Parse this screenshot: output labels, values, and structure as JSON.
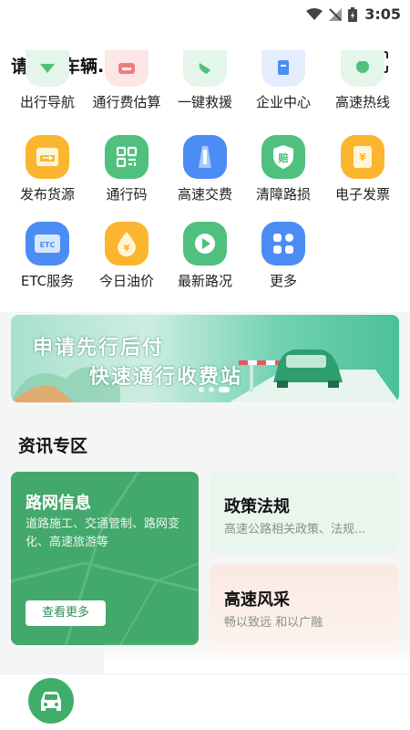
{
  "status": {
    "time": "3:05"
  },
  "header": {
    "title": "请绑定车辆..."
  },
  "menu": [
    {
      "label": "出行导航",
      "icon": "navigation-icon",
      "color": "#4fc07e"
    },
    {
      "label": "通行费估算",
      "icon": "toll-estimate-icon",
      "color": "#f47c7c"
    },
    {
      "label": "一键救援",
      "icon": "phone-icon",
      "color": "#4fc07e"
    },
    {
      "label": "企业中心",
      "icon": "document-icon",
      "color": "#4b8cf5"
    },
    {
      "label": "高速热线",
      "icon": "hotline-icon",
      "color": "#4fc07e"
    },
    {
      "label": "发布货源",
      "icon": "truck-icon",
      "color": "#fcb52e"
    },
    {
      "label": "通行码",
      "icon": "qrcode-icon",
      "color": "#4fc07e"
    },
    {
      "label": "高速交费",
      "icon": "highway-pay-icon",
      "color": "#4b8cf5"
    },
    {
      "label": "清障路损",
      "icon": "compensate-icon",
      "color": "#4fc07e"
    },
    {
      "label": "电子发票",
      "icon": "invoice-icon",
      "color": "#fcb52e"
    },
    {
      "label": "ETC服务",
      "icon": "etc-card-icon",
      "color": "#4b8cf5"
    },
    {
      "label": "今日油价",
      "icon": "oil-drop-icon",
      "color": "#fcb52e"
    },
    {
      "label": "最新路况",
      "icon": "play-icon",
      "color": "#4fc07e"
    },
    {
      "label": "更多",
      "icon": "more-grid-icon",
      "color": "#4b8cf5"
    }
  ],
  "banner": {
    "line1": "申请先行后付",
    "line2": "快速通行收费站"
  },
  "news": {
    "title": "资讯专区",
    "road": {
      "title": "路网信息",
      "desc": "道路施工、交通管制、路网变化、高速旅游等",
      "button": "查看更多"
    },
    "policy": {
      "title": "政策法规",
      "desc": "高速公路相关政策、法规..."
    },
    "style": {
      "title": "高速风采",
      "desc": "畅以致远 和以广融"
    }
  }
}
